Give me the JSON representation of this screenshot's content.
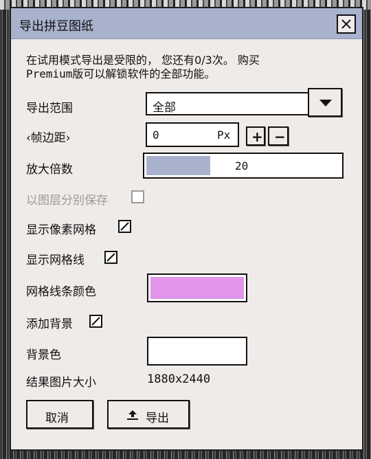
{
  "dialog": {
    "title": "导出拼豆图纸",
    "notice_line1": "在试用模式导出是受限的， 您还有0/3次。 购买",
    "notice_line2": "Premium版可以解锁软件的全部功能。"
  },
  "export_range": {
    "label": "导出范围",
    "value": "全部"
  },
  "frame_margin": {
    "label": "‹帧边距›",
    "value": "0",
    "unit": "Px",
    "plus": "+",
    "minus": "−"
  },
  "zoom": {
    "label": "放大倍数",
    "value": "20",
    "fill_fraction": 0.33
  },
  "save_by_layer": {
    "label": "以图层分别保存",
    "checked": false,
    "enabled": false
  },
  "show_pixel_grid": {
    "label": "显示像素网格",
    "checked": true
  },
  "show_grid_lines": {
    "label": "显示网格线",
    "checked": true
  },
  "grid_line_color": {
    "label": "网格线条颜色",
    "color": "#e195e8"
  },
  "add_background": {
    "label": "添加背景",
    "checked": true
  },
  "background_color": {
    "label": "背景色",
    "color": "#ffffff"
  },
  "result_size": {
    "label": "结果图片大小",
    "value": "1880x2440"
  },
  "buttons": {
    "cancel": "取消",
    "export": "导出"
  },
  "icons": {
    "close": "close-icon",
    "dropdown": "triangle-down-icon",
    "export": "upload-icon"
  }
}
